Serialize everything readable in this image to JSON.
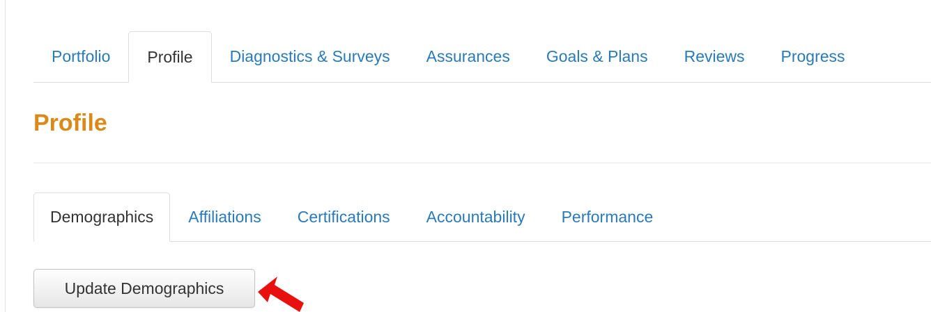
{
  "main_tabs": [
    {
      "label": "Portfolio",
      "active": false
    },
    {
      "label": "Profile",
      "active": true
    },
    {
      "label": "Diagnostics & Surveys",
      "active": false
    },
    {
      "label": "Assurances",
      "active": false
    },
    {
      "label": "Goals & Plans",
      "active": false
    },
    {
      "label": "Reviews",
      "active": false
    },
    {
      "label": "Progress",
      "active": false
    }
  ],
  "page": {
    "title": "Profile"
  },
  "sub_tabs": [
    {
      "label": "Demographics",
      "active": true
    },
    {
      "label": "Affiliations",
      "active": false
    },
    {
      "label": "Certifications",
      "active": false
    },
    {
      "label": "Accountability",
      "active": false
    },
    {
      "label": "Performance",
      "active": false
    }
  ],
  "actions": {
    "update_label": "Update Demographics"
  },
  "colors": {
    "link": "#2a7ab9",
    "title": "#d98a1a",
    "annotation_arrow": "#e8110f"
  },
  "annotation": {
    "icon": "red-arrow-icon"
  }
}
